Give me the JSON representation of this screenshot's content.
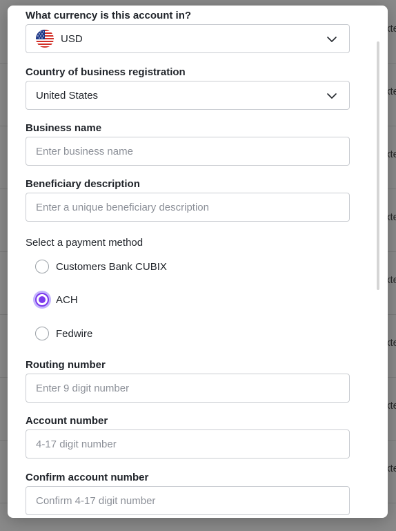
{
  "background": {
    "row_text": "xte"
  },
  "form": {
    "currency": {
      "label": "What currency is this account in?",
      "value": "USD",
      "flag_icon": "us-flag-icon"
    },
    "country": {
      "label": "Country of business registration",
      "value": "United States"
    },
    "business_name": {
      "label": "Business name",
      "placeholder": "Enter business name"
    },
    "beneficiary_description": {
      "label": "Beneficiary description",
      "placeholder": "Enter a unique beneficiary description"
    },
    "payment_method": {
      "heading": "Select a payment method",
      "options": [
        {
          "label": "Customers Bank CUBIX",
          "selected": false
        },
        {
          "label": "ACH",
          "selected": true
        },
        {
          "label": "Fedwire",
          "selected": false
        }
      ]
    },
    "routing_number": {
      "label": "Routing number",
      "placeholder": "Enter 9 digit number"
    },
    "account_number": {
      "label": "Account number",
      "placeholder": "4-17 digit number"
    },
    "confirm_account_number": {
      "label": "Confirm account number",
      "placeholder": "Confirm 4-17 digit number"
    }
  },
  "colors": {
    "accent": "#7c3aed",
    "accent_ring": "#c4b5fd",
    "border": "#c9ccd1",
    "overlay": "#8a8a8a"
  }
}
